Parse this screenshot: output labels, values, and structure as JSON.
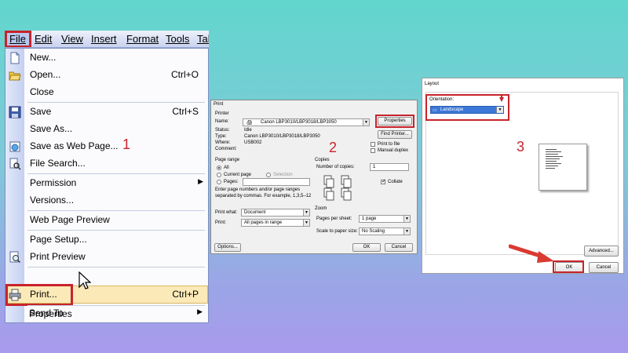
{
  "menubar": {
    "items": [
      "File",
      "Edit",
      "View",
      "Insert",
      "Format",
      "Tools",
      "Tal"
    ]
  },
  "file_menu": {
    "items": [
      {
        "label": "New...",
        "shortcut": "",
        "icon": "new-document-icon"
      },
      {
        "label": "Open...",
        "shortcut": "Ctrl+O",
        "icon": "open-folder-icon"
      },
      {
        "label": "Close",
        "shortcut": "",
        "icon": ""
      },
      {
        "label": "Save",
        "shortcut": "Ctrl+S",
        "icon": "save-disk-icon"
      },
      {
        "label": "Save As...",
        "shortcut": "",
        "icon": ""
      },
      {
        "label": "Save as Web Page...",
        "shortcut": "",
        "icon": "web-page-icon"
      },
      {
        "label": "File Search...",
        "shortcut": "",
        "icon": "file-search-icon"
      },
      {
        "label": "Permission",
        "shortcut": "",
        "icon": ""
      },
      {
        "label": "Versions...",
        "shortcut": "",
        "icon": ""
      },
      {
        "label": "Web Page Preview",
        "shortcut": "",
        "icon": ""
      },
      {
        "label": "Page Setup...",
        "shortcut": "",
        "icon": ""
      },
      {
        "label": "Print Preview",
        "shortcut": "",
        "icon": "print-preview-icon"
      },
      {
        "label": "Print...",
        "shortcut": "Ctrl+P",
        "icon": "printer-icon"
      },
      {
        "label": "Send To",
        "shortcut": "",
        "icon": ""
      },
      {
        "label": "Properties",
        "shortcut": "",
        "icon": ""
      }
    ]
  },
  "step_labels": {
    "one": "1",
    "two": "2",
    "three": "3"
  },
  "print_dialog": {
    "title": "Print",
    "printer_group": "Printer",
    "name_label": "Name:",
    "printer_name": "Canon LBP3010/LBP3018/LBP3050",
    "properties_btn": "Properties",
    "status_label": "Status:",
    "status_value": "Idle",
    "type_label": "Type:",
    "type_value": "Canon LBP3010/LBP3018/LBP3050",
    "where_label": "Where:",
    "where_value": "USB002",
    "comment_label": "Comment:",
    "find_printer_btn": "Find Printer...",
    "print_to_file": "Print to file",
    "manual_duplex": "Manual duplex",
    "page_range_group": "Page range",
    "all": "All",
    "current_page": "Current page",
    "selection": "Selection",
    "pages": "Pages:",
    "help_text_1": "Enter page numbers and/or page ranges",
    "help_text_2": "separated by commas.  For example, 1,3,5–12",
    "copies_group": "Copies",
    "num_copies_label": "Number of copies:",
    "num_copies_value": "1",
    "collate": "Collate",
    "print_what_label": "Print what:",
    "print_what_value": "Document",
    "print_label": "Print:",
    "print_value": "All pages in range",
    "zoom_group": "Zoom",
    "pages_per_sheet_label": "Pages per sheet:",
    "pages_per_sheet_value": "1 page",
    "scale_label": "Scale to paper size:",
    "scale_value": "No Scaling",
    "options_btn": "Options...",
    "ok_btn": "OK",
    "cancel_btn": "Cancel"
  },
  "layout_panel": {
    "title": "Layout",
    "orientation_label": "Orientation:",
    "orientation_value": "Landscape",
    "advanced_btn": "Advanced...",
    "ok_btn": "OK",
    "cancel_btn": "Cancel"
  },
  "colors": {
    "highlight_red": "#c8232b",
    "menu_hover": "#fbeab7",
    "accent_blue": "#3c78d8"
  }
}
